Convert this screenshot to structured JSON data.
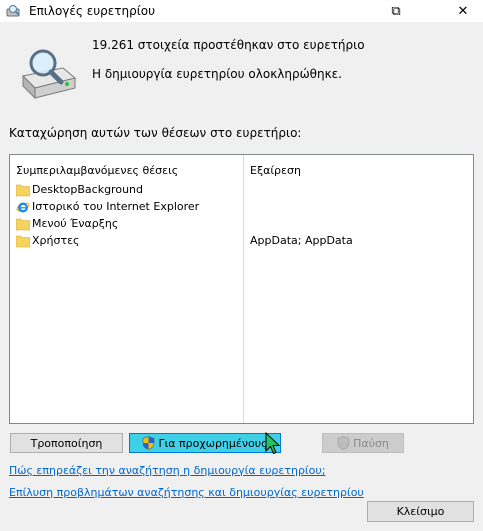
{
  "window": {
    "title": "Επιλογές ευρετηρίου",
    "restore_glyph": "⧉",
    "close_glyph": "✕"
  },
  "status": {
    "items_added": "19.261 στοιχεία προστέθηκαν στο ευρετήριο",
    "message": "Η δημιουργία ευρετηρίου ολοκληρώθηκε."
  },
  "locations": {
    "label": "Καταχώρηση αυτών των θέσεων στο ευρετήριο:",
    "columns": {
      "included": "Συμπεριλαμβανόμενες θέσεις",
      "excluded": "Εξαίρεση"
    },
    "rows": [
      {
        "name": "DesktopBackground",
        "exclude": "",
        "icon": "folder-icon"
      },
      {
        "name": "Ιστορικό του Internet Explorer",
        "exclude": "",
        "icon": "internet-explorer-icon"
      },
      {
        "name": "Μενού Έναρξης",
        "exclude": "",
        "icon": "folder-icon"
      },
      {
        "name": "Χρήστες",
        "exclude": "AppData; AppData",
        "icon": "folder-icon"
      }
    ]
  },
  "buttons": {
    "modify": "Τροποποίηση",
    "advanced": "Για προχωρημένους",
    "pause": "Παύση",
    "close": "Κλείσιμο"
  },
  "links": {
    "how_indexing_affects": "Πώς επηρεάζει την αναζήτηση η δημιουργία ευρετηρίου;",
    "troubleshoot": "Επίλυση προβλημάτων αναζήτησης και δημιουργίας ευρετηρίου"
  },
  "colors": {
    "advanced_button_bg": "#3ed0e6",
    "link": "#0066cc",
    "folder": "#f6d35e"
  }
}
